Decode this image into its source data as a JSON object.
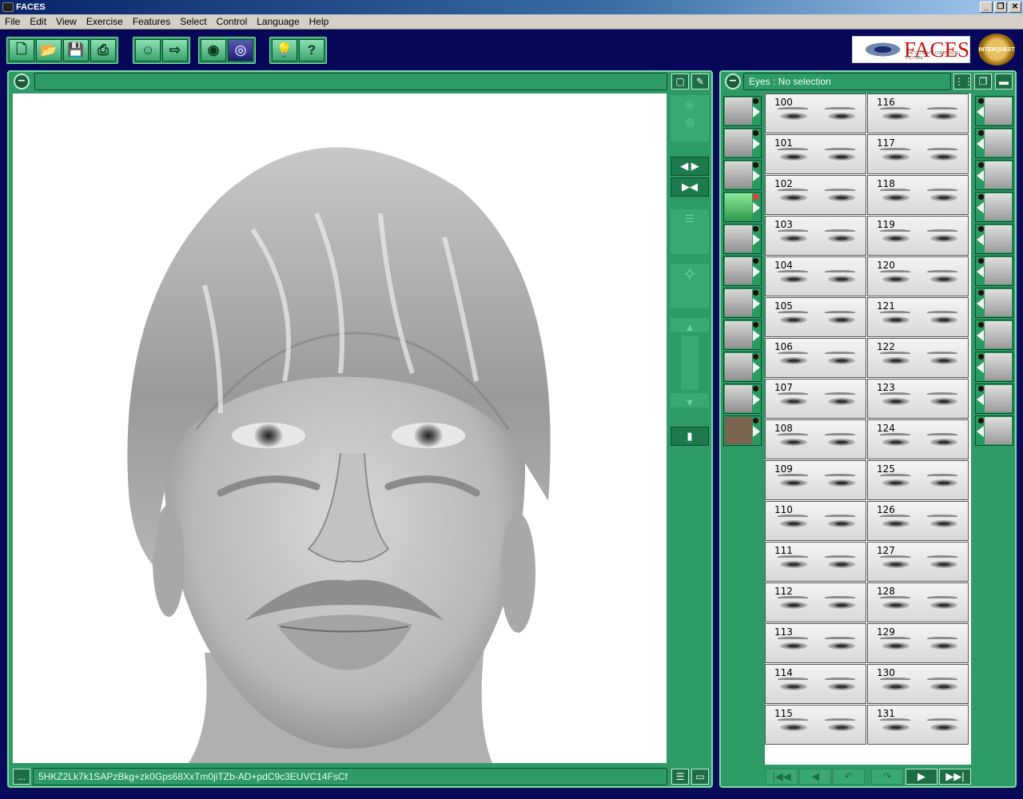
{
  "window": {
    "title": "FACES",
    "min": "_",
    "restore": "❐",
    "close": "✕"
  },
  "menu": [
    "File",
    "Edit",
    "View",
    "Exercise",
    "Features",
    "Select",
    "Control",
    "Language",
    "Help"
  ],
  "toolbar": {
    "group1": [
      {
        "name": "new-icon",
        "glyph": "🗋"
      },
      {
        "name": "open-icon",
        "glyph": "📂"
      },
      {
        "name": "save-icon",
        "glyph": "💾"
      },
      {
        "name": "print-icon",
        "glyph": "⎙"
      }
    ],
    "group2": [
      {
        "name": "face-icon",
        "glyph": "☺"
      },
      {
        "name": "export-icon",
        "glyph": "⇨"
      }
    ],
    "group3": [
      {
        "name": "eye-icon",
        "glyph": "◉"
      },
      {
        "name": "eye-hidden-icon",
        "glyph": "◎"
      }
    ],
    "group4": [
      {
        "name": "hint-icon",
        "glyph": "💡"
      },
      {
        "name": "help-icon",
        "glyph": "?"
      }
    ]
  },
  "brand": {
    "logo_text": "FACES",
    "logo_sub": "THE ULTIMATE COMPOSITE PICTURE",
    "seal_text": "INTERQUEST"
  },
  "left_panel": {
    "code_string": "5HKZ2Lk7k1SAPzBkg+zk0Gps68XxTm0jiTZb-AD+pdC9c3EUVC14FsCf",
    "more_button": "..."
  },
  "right_panel": {
    "header": "Eyes : No selection",
    "selected_feature": "eyes"
  },
  "features": [
    {
      "name": "hair-feature"
    },
    {
      "name": "head-shape-feature"
    },
    {
      "name": "eyebrows-feature"
    },
    {
      "name": "eyes-feature",
      "selected": true
    },
    {
      "name": "nose-feature"
    },
    {
      "name": "lips-feature"
    },
    {
      "name": "chin-feature"
    },
    {
      "name": "moustache-feature"
    },
    {
      "name": "beard-feature"
    },
    {
      "name": "goatee-feature"
    },
    {
      "name": "skin-color-feature"
    }
  ],
  "accessories": [
    {
      "name": "lips-detail-accessory"
    },
    {
      "name": "lips-open-accessory"
    },
    {
      "name": "smile-accessory"
    },
    {
      "name": "teeth-accessory"
    },
    {
      "name": "chin-dimple-accessory"
    },
    {
      "name": "hat-accessory"
    },
    {
      "name": "glasses-accessory"
    },
    {
      "name": "mole-accessory"
    },
    {
      "name": "scar-accessory"
    },
    {
      "name": "earring-accessory"
    },
    {
      "name": "tattoo-accessory"
    }
  ],
  "grid_left": [
    "100",
    "101",
    "102",
    "103",
    "104",
    "105",
    "106",
    "107",
    "108",
    "109",
    "110",
    "111",
    "112",
    "113",
    "114",
    "115"
  ],
  "grid_right": [
    "116",
    "117",
    "118",
    "119",
    "120",
    "121",
    "122",
    "123",
    "124",
    "125",
    "126",
    "127",
    "128",
    "129",
    "130",
    "131"
  ],
  "nav": [
    {
      "name": "first-page-button",
      "glyph": "|◀◀",
      "on": false
    },
    {
      "name": "prev-page-button",
      "glyph": "◀",
      "on": false
    },
    {
      "name": "undo-button",
      "glyph": "↶",
      "on": false
    },
    {
      "name": "redo-button",
      "glyph": "↷",
      "on": false
    },
    {
      "name": "next-page-button",
      "glyph": "▶",
      "on": true
    },
    {
      "name": "last-page-button",
      "glyph": "▶▶|",
      "on": true
    }
  ]
}
